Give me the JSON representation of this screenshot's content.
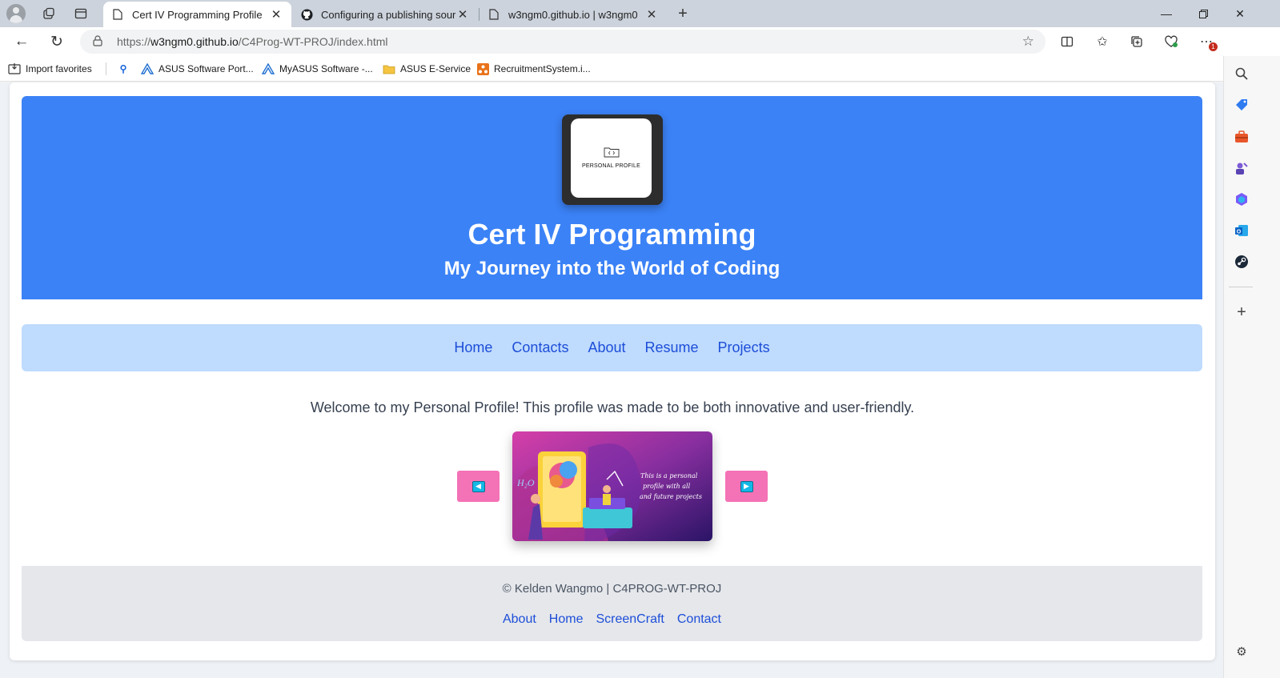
{
  "browser": {
    "tabs": [
      {
        "title": "Cert IV Programming Profile",
        "active": true,
        "favicon": "page-icon"
      },
      {
        "title": "Configuring a publishing source",
        "active": false,
        "favicon": "github-icon"
      },
      {
        "title": "w3ngm0.github.io | w3ngm0",
        "active": false,
        "favicon": "page-icon"
      }
    ],
    "address": {
      "scheme": "https://",
      "host": "w3ngm0.github.io",
      "path": "/C4Prog-WT-PROJ/index.html"
    },
    "notification_count": "1",
    "favorites": [
      {
        "label": "Import favorites",
        "icon": "import-icon"
      },
      {
        "label": "",
        "icon": "search-icon"
      },
      {
        "label": "ASUS Software Port...",
        "icon": "asus-logo-icon"
      },
      {
        "label": "MyASUS Software -...",
        "icon": "asus-logo-icon"
      },
      {
        "label": "ASUS E-Service",
        "icon": "folder-icon"
      },
      {
        "label": "RecruitmentSystem.i...",
        "icon": "app-icon"
      }
    ],
    "colors": {
      "tabbar": "#ccd3dc",
      "accent": "#1463d8"
    }
  },
  "site": {
    "logo_text": "PERSONAL PROFILE",
    "title": "Cert IV Programming",
    "subtitle": "My Journey into the World of Coding",
    "nav": [
      "Home",
      "Contacts",
      "About",
      "Resume",
      "Projects"
    ],
    "welcome": "Welcome to my Personal Profile! This profile was made to be both innovative and user-friendly.",
    "carousel": {
      "slide_text": [
        "This is  a personal",
        "profile with all",
        "and future projects"
      ],
      "prev_icon": "triangle-left-icon",
      "next_icon": "triangle-right-icon"
    },
    "footer": {
      "copyright": "© Kelden Wangmo | C4PROG-WT-PROJ",
      "links": [
        "About",
        "Home",
        "ScreenCraft",
        "Contact"
      ]
    },
    "colors": {
      "hero": "#3b82f6",
      "nav_bg": "#bfdbfe",
      "link": "#1d4ed8",
      "carousel_button": "#f472b6",
      "footer_bg": "#e5e7eb"
    }
  }
}
